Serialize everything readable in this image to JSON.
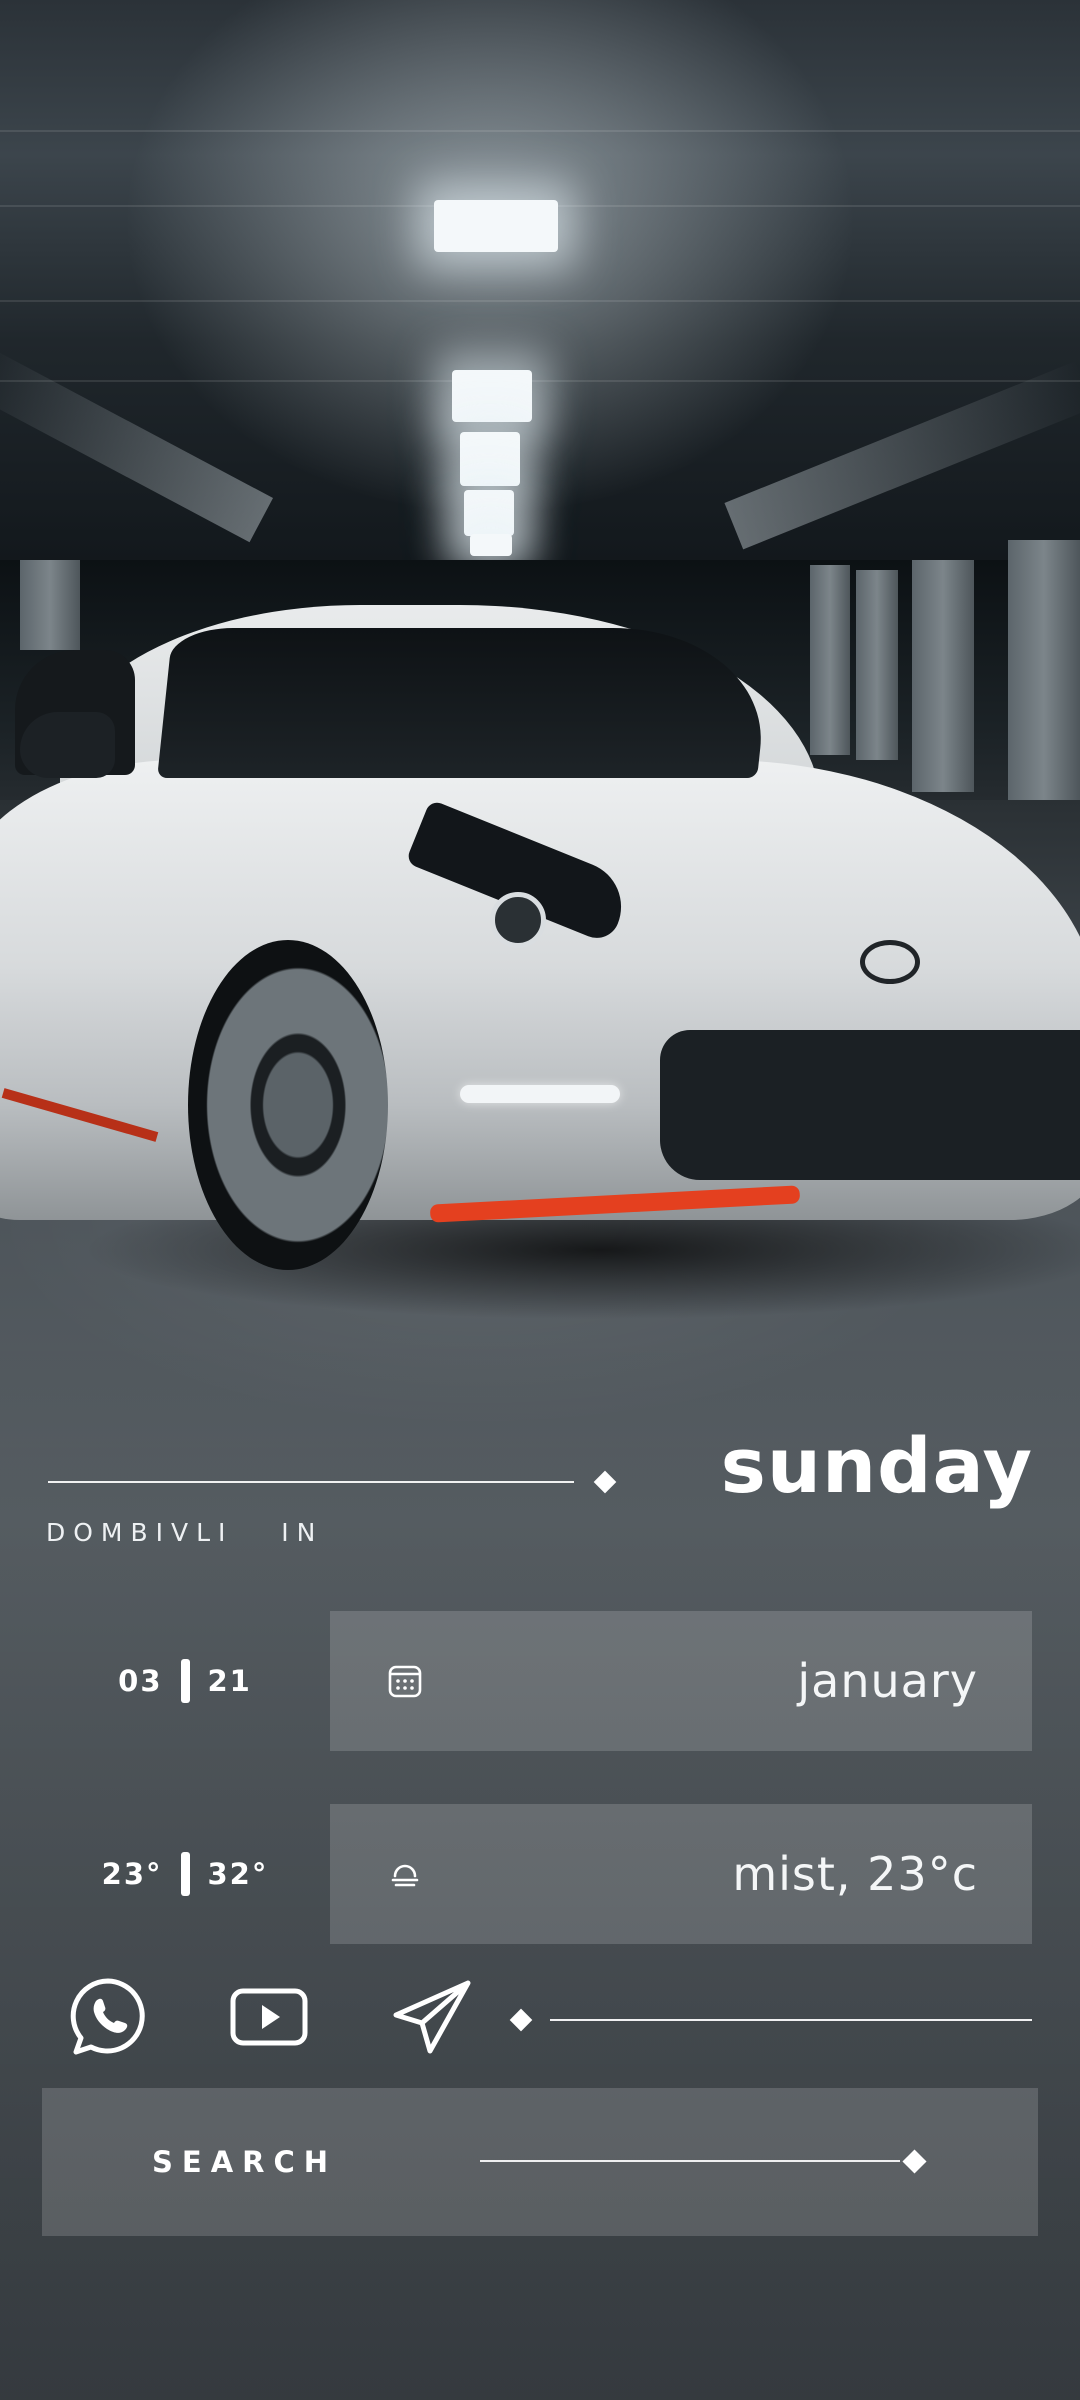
{
  "header": {
    "day": "sunday",
    "location": "DOMBIVLI   IN"
  },
  "date_row": {
    "day": "03",
    "year": "21",
    "month": "january",
    "icon": "calendar-icon"
  },
  "weather_row": {
    "temp_min": "23°",
    "temp_max": "32°",
    "condition": "mist, 23°c",
    "icon": "mist-icon"
  },
  "apps": [
    {
      "name": "whatsapp",
      "icon": "whatsapp-icon"
    },
    {
      "name": "youtube",
      "icon": "youtube-icon"
    },
    {
      "name": "telegram",
      "icon": "telegram-icon"
    }
  ],
  "search": {
    "label": "SEARCH"
  },
  "colors": {
    "text": "#ffffff",
    "panel": "rgba(255,255,255,0.16)",
    "accent_red": "#e4401f"
  }
}
